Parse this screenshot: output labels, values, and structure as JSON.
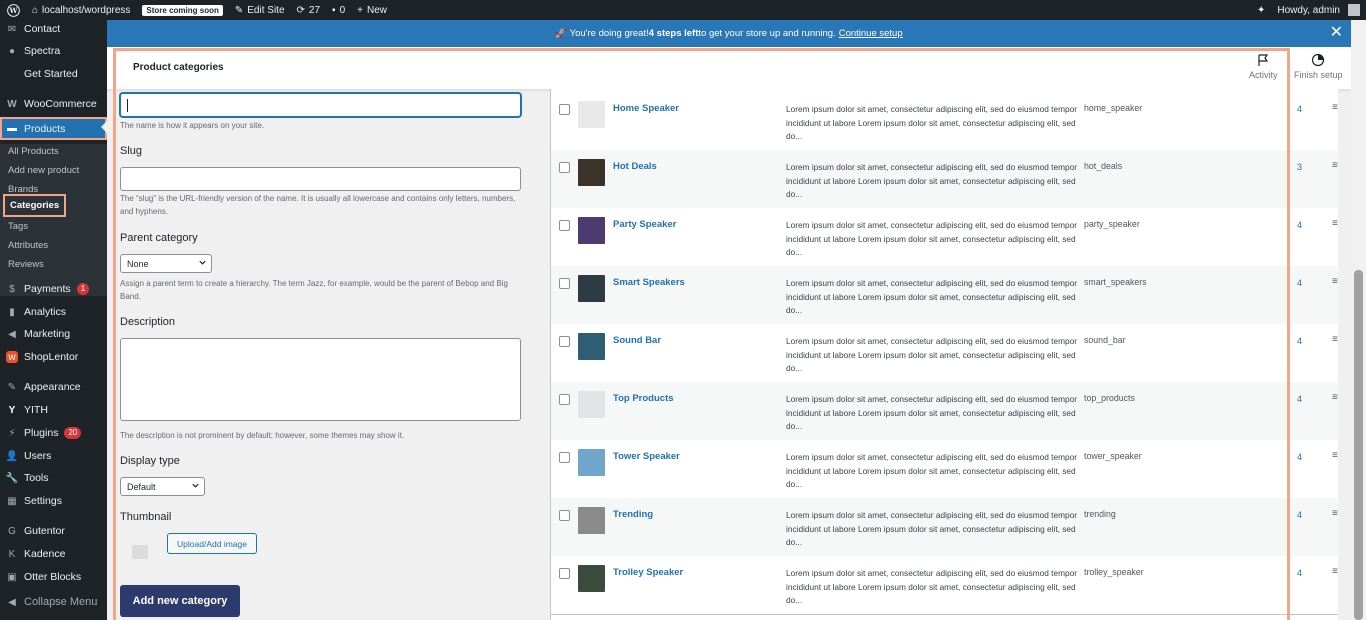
{
  "admin_bar": {
    "site_name": "localhost/wordpress",
    "store_badge": "Store coming soon",
    "edit_site": "Edit Site",
    "updates_count": "27",
    "comments_count": "0",
    "new_label": "New",
    "howdy": "Howdy, admin"
  },
  "sidebar": {
    "items": [
      {
        "label": "Contact",
        "icon": "contact-icon"
      },
      {
        "label": "Spectra",
        "icon": "spectra-icon"
      },
      {
        "label": "Get Started",
        "icon": ""
      },
      {
        "label": "WooCommerce",
        "icon": "woocommerce-icon"
      },
      {
        "label": "Products",
        "icon": "products-icon"
      },
      {
        "label": "Payments",
        "icon": "payments-icon",
        "badge": "1"
      },
      {
        "label": "Analytics",
        "icon": "analytics-icon"
      },
      {
        "label": "Marketing",
        "icon": "marketing-icon"
      },
      {
        "label": "ShopLentor",
        "icon": "shoplentor-icon"
      },
      {
        "label": "Appearance",
        "icon": "appearance-icon"
      },
      {
        "label": "YITH",
        "icon": "yith-icon"
      },
      {
        "label": "Plugins",
        "icon": "plugins-icon",
        "badge": "20"
      },
      {
        "label": "Users",
        "icon": "users-icon"
      },
      {
        "label": "Tools",
        "icon": "tools-icon"
      },
      {
        "label": "Settings",
        "icon": "settings-icon"
      },
      {
        "label": "Gutentor",
        "icon": "gutentor-icon"
      },
      {
        "label": "Kadence",
        "icon": "kadence-icon"
      },
      {
        "label": "Otter Blocks",
        "icon": "otter-icon"
      },
      {
        "label": "Collapse Menu",
        "icon": "collapse-icon"
      }
    ],
    "submenu": [
      "All Products",
      "Add new product",
      "Brands",
      "Categories",
      "Tags",
      "Attributes",
      "Reviews"
    ]
  },
  "notice": {
    "text_before": "🚀 You're doing great! ",
    "bold": "4 steps left",
    "text_after": " to get your store up and running.",
    "link": "Continue setup"
  },
  "header": {
    "title": "Product categories",
    "activity": "Activity",
    "finish_setup": "Finish setup"
  },
  "form": {
    "name_help": "The name is how it appears on your site.",
    "slug_label": "Slug",
    "slug_help": "The “slug” is the URL-friendly version of the name. It is usually all lowercase and contains only letters, numbers, and hyphens.",
    "parent_label": "Parent category",
    "parent_value": "None",
    "parent_help": "Assign a parent term to create a hierarchy. The term Jazz, for example, would be the parent of Bebop and Big Band.",
    "description_label": "Description",
    "description_help": "The description is not prominent by default; however, some themes may show it.",
    "display_type_label": "Display type",
    "display_type_value": "Default",
    "thumbnail_label": "Thumbnail",
    "upload_button": "Upload/Add image",
    "add_button": "Add new category"
  },
  "categories": [
    {
      "name": "Home Speaker",
      "slug": "home_speaker",
      "count": "4",
      "thumb_color": "#e9e9e9"
    },
    {
      "name": "Hot Deals",
      "slug": "hot_deals",
      "count": "3",
      "thumb_color": "#3b3229"
    },
    {
      "name": "Party Speaker",
      "slug": "party_speaker",
      "count": "4",
      "thumb_color": "#4d3a6e"
    },
    {
      "name": "Smart Speakers",
      "slug": "smart_speakers",
      "count": "4",
      "thumb_color": "#2e3b45"
    },
    {
      "name": "Sound Bar",
      "slug": "sound_bar",
      "count": "4",
      "thumb_color": "#2f5d73"
    },
    {
      "name": "Top Products",
      "slug": "top_products",
      "count": "4",
      "thumb_color": "#e3e4e5"
    },
    {
      "name": "Tower Speaker",
      "slug": "tower_speaker",
      "count": "4",
      "thumb_color": "#6fa6c9"
    },
    {
      "name": "Trending",
      "slug": "trending",
      "count": "4",
      "thumb_color": "#8a8a8a"
    },
    {
      "name": "Trolley Speaker",
      "slug": "trolley_speaker",
      "count": "4",
      "thumb_color": "#3a4a3d"
    }
  ],
  "description_text": "Lorem ipsum dolor sit amet, consectetur adipiscing elit, sed do eiusmod tempor incididunt ut labore Lorem ipsum dolor sit amet, consectetur adipiscing elit, sed do..."
}
